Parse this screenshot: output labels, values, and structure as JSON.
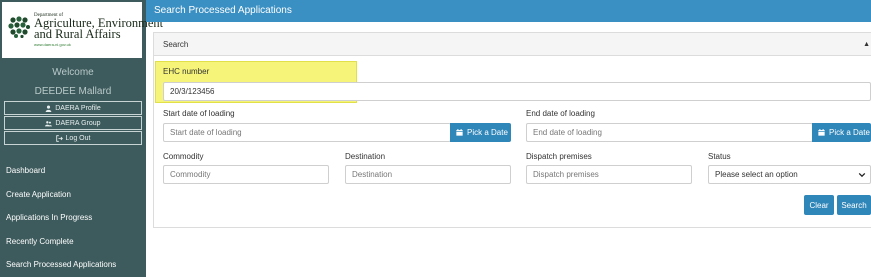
{
  "logo": {
    "dept_line": "Department of",
    "line1": "Agriculture, Environment",
    "line2": "and Rural Affairs",
    "url": "www.daera-ni.gov.uk"
  },
  "sidebar": {
    "welcome": "Welcome",
    "user_name": "DEEDEE Mallard",
    "profile_buttons": [
      {
        "label": "DAERA Profile",
        "icon": "user-icon"
      },
      {
        "label": "DAERA Group",
        "icon": "users-icon"
      },
      {
        "label": "Log Out",
        "icon": "logout-icon"
      }
    ],
    "nav": [
      {
        "label": "Dashboard"
      },
      {
        "label": "Create Application"
      },
      {
        "label": "Applications In Progress"
      },
      {
        "label": "Recently Complete"
      },
      {
        "label": "Search Processed Applications"
      }
    ],
    "color": "#3d5a5c"
  },
  "header": {
    "title": "Search Processed Applications",
    "color": "#3a8fc3"
  },
  "search": {
    "panel_title": "Search",
    "ehc": {
      "label": "EHC number",
      "value": "20/3/123456"
    },
    "start_date": {
      "label": "Start date of loading",
      "placeholder": "Start date of loading",
      "button": "Pick a Date"
    },
    "end_date": {
      "label": "End date of loading",
      "placeholder": "End date of loading",
      "button": "Pick a Date"
    },
    "commodity": {
      "label": "Commodity",
      "placeholder": "Commodity"
    },
    "destination": {
      "label": "Destination",
      "placeholder": "Destination"
    },
    "dispatch": {
      "label": "Dispatch premises",
      "placeholder": "Dispatch premises"
    },
    "status": {
      "label": "Status",
      "selected": "Please select an option"
    },
    "clear_label": "Clear",
    "search_label": "Search",
    "highlight_color": "#f6f57a",
    "button_color": "#2f86b9"
  }
}
